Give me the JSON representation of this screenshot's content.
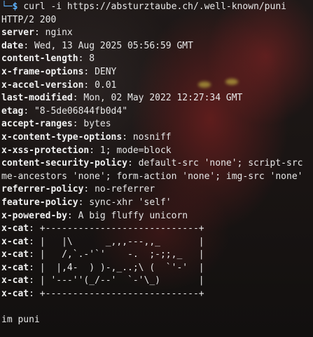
{
  "prompt": {
    "corner": "└─",
    "symbol": "$",
    "command": "curl -i https://absturztaube.ch/.well-known/puni"
  },
  "status_line": "HTTP/2 200",
  "headers": [
    {
      "key": "server",
      "value": "nginx"
    },
    {
      "key": "date",
      "value": "Wed, 13 Aug 2025 05:56:59 GMT"
    },
    {
      "key": "content-length",
      "value": "8"
    },
    {
      "key": "x-frame-options",
      "value": "DENY"
    },
    {
      "key": "x-accel-version",
      "value": "0.01"
    },
    {
      "key": "last-modified",
      "value": "Mon, 02 May 2022 12:27:34 GMT"
    },
    {
      "key": "etag",
      "value": "\"8-5de06844fb0d4\""
    },
    {
      "key": "accept-ranges",
      "value": "bytes"
    },
    {
      "key": "x-content-type-options",
      "value": "nosniff"
    },
    {
      "key": "x-xss-protection",
      "value": "1; mode=block"
    },
    {
      "key": "content-security-policy",
      "value": "default-src 'none'; script-src"
    },
    {
      "key": "",
      "value": "me-ancestors 'none'; form-action 'none'; img-src 'none'"
    },
    {
      "key": "referrer-policy",
      "value": "no-referrer"
    },
    {
      "key": "feature-policy",
      "value": "sync-xhr 'self'"
    },
    {
      "key": "x-powered-by",
      "value": "A big fluffy unicorn"
    },
    {
      "key": "x-cat",
      "value": "+----------------------------+"
    },
    {
      "key": "x-cat",
      "value": "|   |\\      _,,,---,,_       |"
    },
    {
      "key": "x-cat",
      "value": "|   /,`.-'`'    -.  ;-;;,_   |"
    },
    {
      "key": "x-cat",
      "value": "|  |,4-  ) )-,_..;\\ (  `'-'  |"
    },
    {
      "key": "x-cat",
      "value": "| '---''(_/--'  `-'\\_)       |"
    },
    {
      "key": "x-cat",
      "value": "+----------------------------+"
    }
  ],
  "body_text": "im puni"
}
